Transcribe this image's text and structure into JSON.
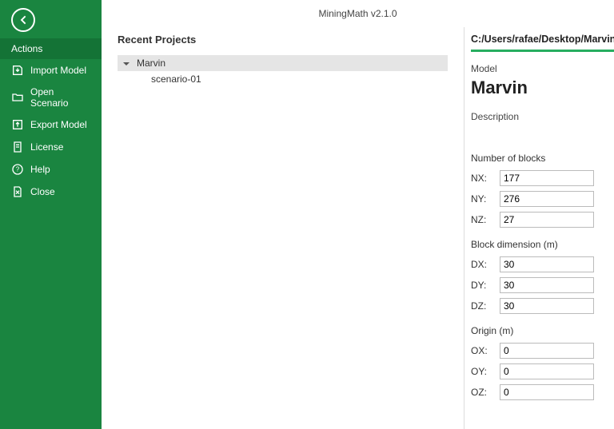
{
  "app": {
    "title": "MiningMath v2.1.0"
  },
  "sidebar": {
    "section": "Actions",
    "items": [
      {
        "label": "Import Model"
      },
      {
        "label": "Open Scenario"
      },
      {
        "label": "Export Model"
      },
      {
        "label": "License"
      },
      {
        "label": "Help"
      },
      {
        "label": "Close"
      }
    ]
  },
  "recent": {
    "heading": "Recent Projects",
    "project": "Marvin",
    "scenario": "scenario-01"
  },
  "details": {
    "path": "C:/Users/rafae/Desktop/Marvin",
    "model_label": "Model",
    "model_name": "Marvin",
    "description_label": "Description",
    "description": "",
    "blocks": {
      "title": "Number of blocks",
      "nx_label": "NX:",
      "ny_label": "NY:",
      "nz_label": "NZ:",
      "nx": "177",
      "ny": "276",
      "nz": "27"
    },
    "dim": {
      "title": "Block dimension (m)",
      "dx_label": "DX:",
      "dy_label": "DY:",
      "dz_label": "DZ:",
      "dx": "30",
      "dy": "30",
      "dz": "30"
    },
    "origin": {
      "title": "Origin (m)",
      "ox_label": "OX:",
      "oy_label": "OY:",
      "oz_label": "OZ:",
      "ox": "0",
      "oy": "0",
      "oz": "0"
    }
  }
}
